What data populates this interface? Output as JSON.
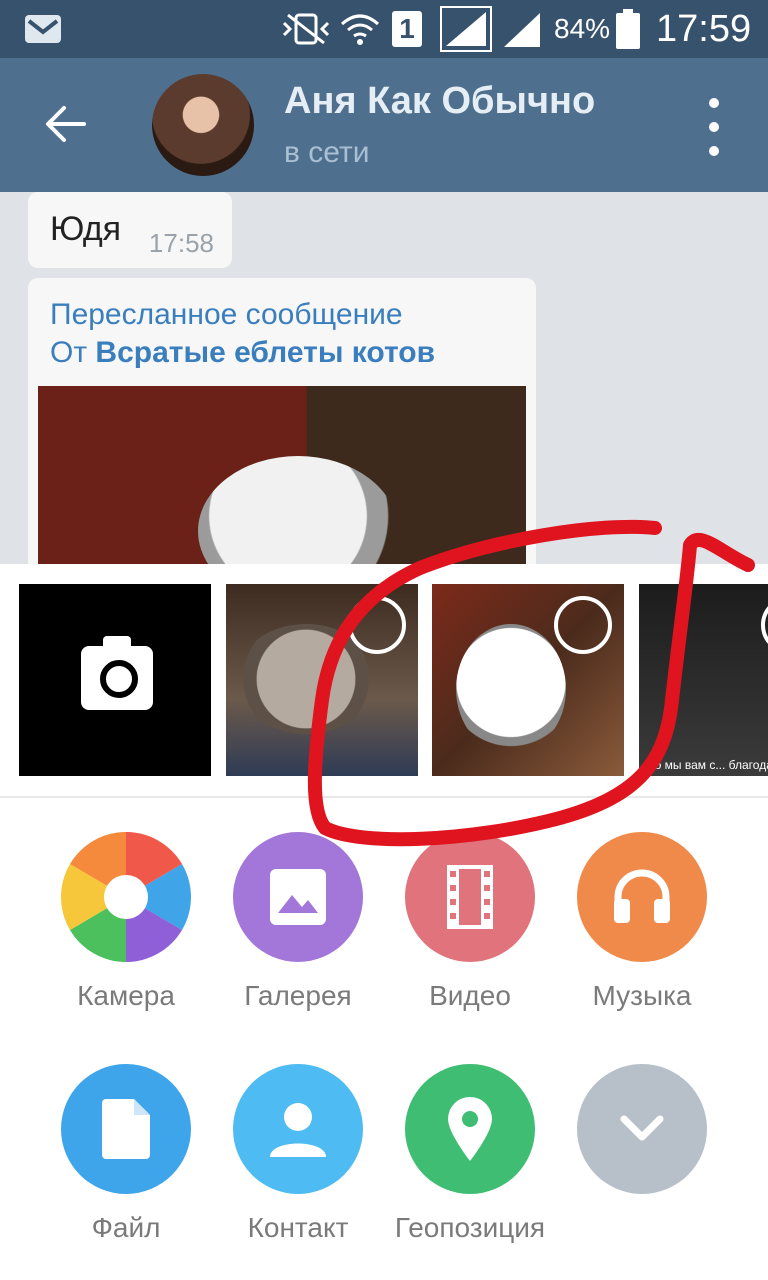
{
  "status_bar": {
    "mail_icon": "gmail-icon",
    "battery": "84%",
    "time": "17:59",
    "sim": "1",
    "colors": {
      "bg": "#37526c"
    }
  },
  "header": {
    "title": "Аня Как Обычно",
    "subtitle": "в сети",
    "colors": {
      "bg": "#4f6f8e"
    }
  },
  "messages": [
    {
      "text": "Юдя",
      "time": "17:58"
    },
    {
      "forward_label": "Пересланное сообщение",
      "from_prefix": "От",
      "from_name": "Всратые еблеты котов"
    }
  ],
  "attach_sheet": {
    "thumbnail_caption": "что мы вам с... благодаря от му..."
  },
  "actions": [
    {
      "label": "Камера",
      "color": "#ffffff"
    },
    {
      "label": "Галерея",
      "color": "#a377d9"
    },
    {
      "label": "Видео",
      "color": "#e0737c"
    },
    {
      "label": "Музыка",
      "color": "#f08a4b"
    },
    {
      "label": "Файл",
      "color": "#3fa5ea"
    },
    {
      "label": "Контакт",
      "color": "#4ebcf2"
    },
    {
      "label": "Геопозиция",
      "color": "#3fbe73"
    },
    {
      "label": "",
      "color": "#b7c0c9"
    }
  ],
  "annotation": {
    "color": "#e0141e"
  }
}
